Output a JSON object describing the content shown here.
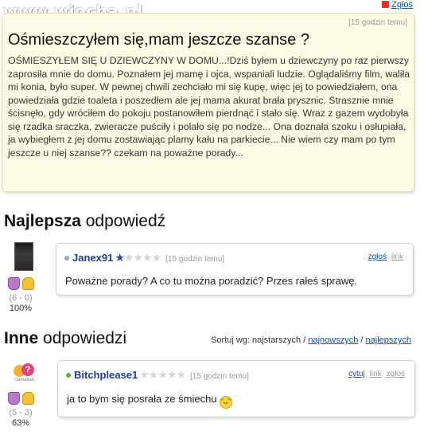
{
  "watermark": "www.wiocha.pl",
  "top_report": "Zgłoś",
  "question": {
    "time": "[15 godzin temu]",
    "title": "Ośmieszczyłem się,mam jeszcze szanse ?",
    "body": "OŚMIESZYŁEM SIĘ U DZIEWCZYNY W DOMU...!Dziś byłem u dziewczyny po raz pierwszy zaprosiła mnie do domu. Poznałem jej mamę i ojca, wspaniali ludzie. Oglądaliśmy film, waliła mi konia, było super. W pewnej chwili zechciało mi się kupę, więc jej to powiedziałem, ona powiedziała gdzie toaleta i poszedłem ale jej mama akurat brała prysznic. Strasznie mnie ścisnęło, gdy wróciłem do pokoju postanowiłem pierdnąć i stało się. Wraz z gazem wydobyła się rzadka sraczka, zwieracze puściły i polało się po nodze... Ona doznała szoku i osłupiała, ja wybiegłem z jej domu zostawiając plamy kału na parkiecie... Nie wiem czy mam po tym jeszcze u niej szanse?? czekam na poważne porady..."
  },
  "best": {
    "heading_bold": "Najlepsza",
    "heading_rest": "odpowiedź",
    "answer": {
      "user": "Janex91",
      "stars_filled": 1,
      "stars_total": 5,
      "time": "[15 godzin temu]",
      "report": "zgłoś",
      "link": "link",
      "text": "Poważne porady? A co tu można poradzić? Przes rałeś sprawę.",
      "votes": "(6 - 0)",
      "percent": "100%",
      "dot_color": "#9aa9c9"
    }
  },
  "other": {
    "heading_bold": "Inne",
    "heading_rest": "odpowiedzi",
    "sort": {
      "label": "Sortuj wg: najstarszych /",
      "newest": "najnowszych",
      "sep": "/",
      "best": "najlepszych"
    },
    "avatar_glyph": "?",
    "avatar_caption": "camelian",
    "answer": {
      "user": "Bitchplease1",
      "stars_filled": 0,
      "stars_total": 5,
      "time": "[15 godzin temu]",
      "quote": "cytuj",
      "link": "link",
      "report": "zgłoś",
      "text": "ja to bym się posrała ze śmiechu",
      "smiley": "ᵔᴗᵔ",
      "votes": "(5 - 3)",
      "percent": "63%",
      "dot_color": "#6aa84f"
    }
  },
  "colors": {
    "accent_link": "#1a4a9b",
    "question_bg": "#fdfbe6",
    "username": "#1a3d8f"
  }
}
